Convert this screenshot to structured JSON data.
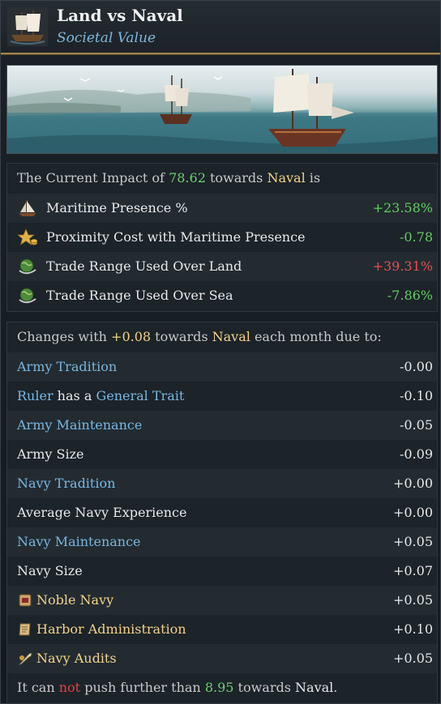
{
  "header": {
    "title": "Land vs Naval",
    "subtitle": "Societal Value"
  },
  "impact": {
    "prefix": "The Current Impact of ",
    "value": "78.62",
    "middle": " towards ",
    "target": "Naval",
    "suffix": " is",
    "items": [
      {
        "label": "Maritime Presence %",
        "value": "+23.58%",
        "icon": "sailboat-icon"
      },
      {
        "label": "Proximity Cost with Maritime Presence",
        "value": "-0.78",
        "icon": "star-coins-icon"
      },
      {
        "label": "Trade Range Used Over Land",
        "value": "+39.31%",
        "icon": "globe-icon"
      },
      {
        "label": "Trade Range Used Over Sea",
        "value": "-7.86%",
        "icon": "globe-icon"
      }
    ]
  },
  "changes": {
    "prefix": "Changes with ",
    "value": "+0.08",
    "middle": " towards ",
    "target": "Naval",
    "suffix": " each month due to:",
    "items": [
      {
        "label": "Army Tradition",
        "value": "-0.00"
      },
      {
        "label_a": "Ruler",
        "label_b": " has a ",
        "label_c": "General Trait",
        "value": "-0.10"
      },
      {
        "label": "Army Maintenance",
        "value": "-0.05"
      },
      {
        "label": "Army Size",
        "value": "-0.09"
      },
      {
        "label": "Navy Tradition",
        "value": "+0.00"
      },
      {
        "label": "Average Navy Experience",
        "value": "+0.00"
      },
      {
        "label": "Navy Maintenance",
        "value": "+0.05"
      },
      {
        "label": "Navy Size",
        "value": "+0.07"
      },
      {
        "label": "Noble Navy",
        "value": "+0.05",
        "icon": "scroll-icon"
      },
      {
        "label": "Harbor Administration",
        "value": "+0.10",
        "icon": "parchment-icon"
      },
      {
        "label": "Navy Audits",
        "value": "+0.05",
        "icon": "quill-icon"
      }
    ]
  },
  "footer": {
    "a": "It can ",
    "b": "not",
    "c": " push further than ",
    "d": "8.95",
    "e": " towards ",
    "f": "Naval",
    "g": "."
  },
  "colors": {
    "positive": "#5fd15f",
    "negative": "#e05252",
    "link": "#79b6e0",
    "highlight": "#f2d28a"
  }
}
